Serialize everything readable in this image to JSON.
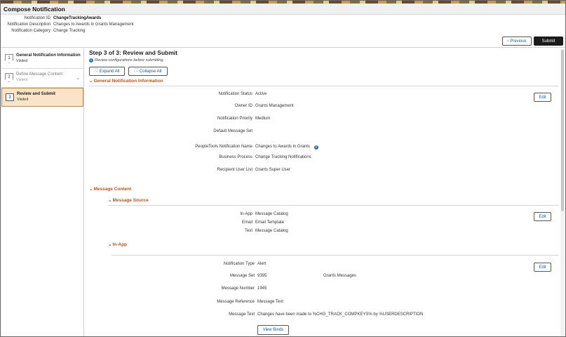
{
  "window": {
    "title": "Compose Notification"
  },
  "header": {
    "fields": [
      {
        "label": "Notification ID",
        "value": "ChangeTrackingAwards",
        "bold": true
      },
      {
        "label": "Notification Description",
        "value": "Changes to Awards in Grants Management",
        "bold": false
      },
      {
        "label": "Notification Category",
        "value": "Change Tracking",
        "bold": false
      }
    ],
    "previous_label": "Previous",
    "previous_icon": "chevron-left-icon",
    "submit_label": "Submit"
  },
  "sidebar": {
    "steps": [
      {
        "number": "1",
        "title": "General Notification Information",
        "status": "Visited",
        "state": "visited"
      },
      {
        "number": "2",
        "title": "Define Message Content",
        "status": "Visited",
        "state": "collapsed"
      },
      {
        "number": "3",
        "title": "Review and Submit",
        "status": "Visited",
        "state": "active"
      }
    ]
  },
  "main": {
    "step_title": "Step 3 of 3: Review and Submit",
    "info_text": "Review configurations before submitting.",
    "expand_all_label": "Expand All",
    "collapse_all_label": "Collapse All",
    "general": {
      "title": "General Notification Information",
      "edit_label": "Edit",
      "fields": [
        {
          "label": "Notification Status",
          "value": "Active"
        },
        {
          "label": "Owner ID",
          "value": "Grants Management"
        },
        {
          "label": "Notification Priority",
          "value": "Medium"
        },
        {
          "label": "Default Message Set",
          "value": ""
        },
        {
          "label": "PeopleTools Notification Name",
          "value": "Changes to Awards in Grants",
          "info_icon": true
        },
        {
          "label": "Business Process",
          "value": "Change Tracking Notifications"
        },
        {
          "label": "Recipient User List",
          "value": "Grants Super User"
        }
      ]
    },
    "message_content": {
      "title": "Message Content",
      "message_source": {
        "title": "Message Source",
        "edit_label": "Edit",
        "fields": [
          {
            "label": "In-App",
            "value": "Message Catalog"
          },
          {
            "label": "Email",
            "value": "Email Template"
          },
          {
            "label": "Text",
            "value": "Message Catalog"
          }
        ]
      },
      "in_app": {
        "title": "In-App",
        "edit_label": "Edit",
        "fields": [
          {
            "label": "Notification Type",
            "value": "Alert"
          },
          {
            "label": "Message Set",
            "value": "9395",
            "value2": "Grants Messages"
          },
          {
            "label": "Message Number",
            "value": "1945"
          },
          {
            "label": "Message Reference",
            "value": "Message Text"
          },
          {
            "label": "Message Text",
            "value": "Changes have been made to %CHG_TRACK_COMPKEYS% by %USERDESCRIPTION"
          }
        ],
        "view_binds_label": "View Binds"
      }
    }
  },
  "colors": {
    "section_title": "#b4541e",
    "link_blue": "#1a5a96",
    "active_step_bg": "#fae3c6",
    "submit_bg": "#1b1b1b"
  }
}
